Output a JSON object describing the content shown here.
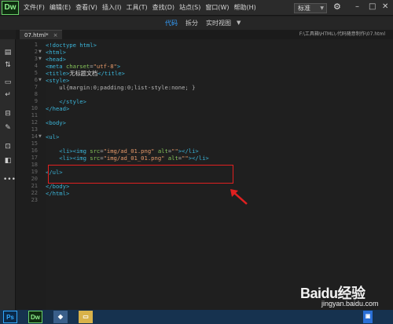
{
  "app": {
    "logo": "Dw"
  },
  "menu": [
    "文件(F)",
    "编辑(E)",
    "查看(V)",
    "插入(I)",
    "工具(T)",
    "查找(D)",
    "站点(S)",
    "窗口(W)",
    "帮助(H)"
  ],
  "workspace": {
    "label": "标准"
  },
  "view_tabs": {
    "code": "代码",
    "split": "拆分",
    "live": "实时视图"
  },
  "document": {
    "tab": "07.html*",
    "path": "F:\\工具箱\\HTML\\-代码随意制作\\07.html"
  },
  "toolbar_icons": [
    "file-icon",
    "format-icon",
    "comment-icon",
    "wrap-icon",
    "snippet-icon",
    "brush-icon",
    "preview-icon",
    "book-icon",
    "more-icon"
  ],
  "line_numbers": [
    "1",
    "2",
    "3",
    "4",
    "5",
    "6",
    "7",
    "8",
    "9",
    "10",
    "11",
    "12",
    "13",
    "14",
    "15",
    "16",
    "17",
    "18",
    "19",
    "20",
    "21",
    "22",
    "23"
  ],
  "code": {
    "l1": "<!doctype html>",
    "l2": "<html>",
    "l3": "<head>",
    "l4_open": "<meta ",
    "l4_attr": "charset",
    "l4_eq": "=",
    "l4_val": "\"utf-8\"",
    "l4_close": ">",
    "l5_open": "<title>",
    "l5_text": "无标题文档",
    "l5_close": "</title>",
    "l6": "<style>",
    "l7": "    ul{margin:0;padding:0;list-style:none; }",
    "l9": "    </style>",
    "l10": "</head>",
    "l12": "<body>",
    "l14": "<ul>",
    "l16_a": "    <li><img ",
    "l16_src": "src",
    "l16_eq": "=",
    "l16_val": "\"img/ad_01.png\"",
    "l16_alt": " alt",
    "l16_altv": "\"\"",
    "l16_end": "></li>",
    "l17_a": "    <li><img ",
    "l17_src": "src",
    "l17_eq": "=",
    "l17_val": "\"img/ad_01_01.png\"",
    "l17_alt": " alt",
    "l17_altv": "\"\"",
    "l17_end": "></li>",
    "l19": "</ul>",
    "l21": "</body>",
    "l22": "</html>"
  },
  "colors": {
    "annotation": "#e02020",
    "active_tab": "#35a0ff",
    "tag": "#3bb5d9"
  },
  "watermark": {
    "logo": "Baidu经验",
    "url": "jingyan.baidu.com"
  },
  "taskbar": {
    "ps": "Ps",
    "dw": "Dw"
  }
}
